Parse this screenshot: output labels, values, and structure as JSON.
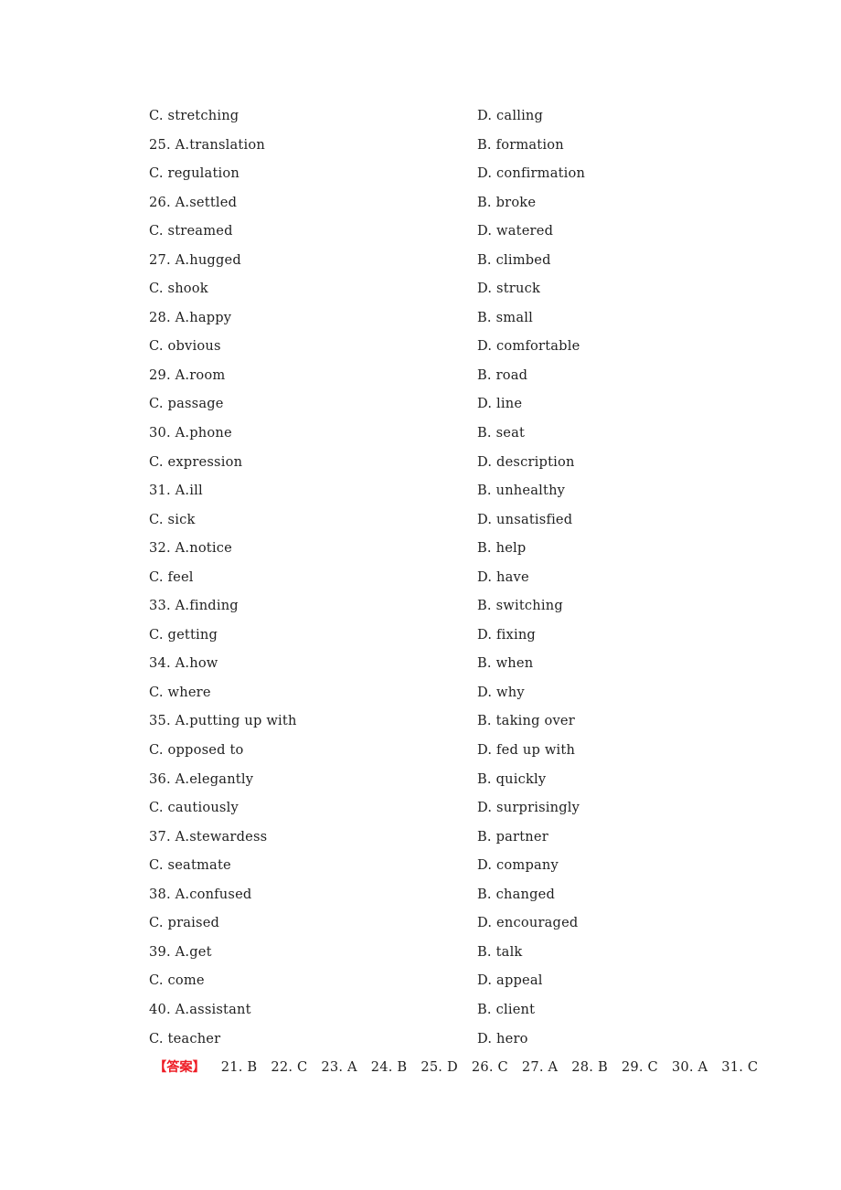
{
  "document": {
    "page_background": "#ffffff",
    "text_color": "#1f1f1f",
    "accent_color": "#ee1c25"
  },
  "option_lines": [
    {
      "left": "C. stretching",
      "right": "D. calling"
    },
    {
      "left": "25. A.translation",
      "right": "B. formation"
    },
    {
      "left": "C. regulation",
      "right": "D. confirmation"
    },
    {
      "left": "26. A.settled",
      "right": "B. broke"
    },
    {
      "left": "C. streamed",
      "right": "D. watered"
    },
    {
      "left": "27. A.hugged",
      "right": "B. climbed"
    },
    {
      "left": "C. shook",
      "right": "D. struck"
    },
    {
      "left": "28. A.happy",
      "right": "B. small"
    },
    {
      "left": "C. obvious",
      "right": "D. comfortable"
    },
    {
      "left": "29. A.room",
      "right": "B. road"
    },
    {
      "left": "C. passage",
      "right": "D. line"
    },
    {
      "left": "30. A.phone",
      "right": "B. seat"
    },
    {
      "left": "C. expression",
      "right": "D. description"
    },
    {
      "left": "31. A.ill",
      "right": "B. unhealthy"
    },
    {
      "left": "C. sick",
      "right": "D. unsatisfied"
    },
    {
      "left": "32. A.notice",
      "right": "B. help"
    },
    {
      "left": "C. feel",
      "right": "D. have"
    },
    {
      "left": "33. A.finding",
      "right": "B. switching"
    },
    {
      "left": "C. getting",
      "right": "D. fixing"
    },
    {
      "left": "34. A.how",
      "right": "B. when"
    },
    {
      "left": "C. where",
      "right": "D. why"
    },
    {
      "left": "35. A.putting up with",
      "right": "B. taking over"
    },
    {
      "left": "C. opposed to",
      "right": "D. fed up with"
    },
    {
      "left": "36. A.elegantly",
      "right": "B. quickly"
    },
    {
      "left": "C. cautiously",
      "right": "D. surprisingly"
    },
    {
      "left": "37. A.stewardess",
      "right": "B. partner"
    },
    {
      "left": "C. seatmate",
      "right": "D. company"
    },
    {
      "left": "38. A.confused",
      "right": "B. changed"
    },
    {
      "left": "C. praised",
      "right": "D. encouraged"
    },
    {
      "left": "39. A.get",
      "right": "B. talk"
    },
    {
      "left": "C. come",
      "right": "D. appeal"
    },
    {
      "left": "40. A.assistant",
      "right": "B. client"
    },
    {
      "left": "C. teacher",
      "right": "D. hero"
    }
  ],
  "answer_key": {
    "label": "【答案】",
    "items": [
      "21. B",
      "22. C",
      "23. A",
      "24. B",
      "25. D",
      "26. C",
      "27. A",
      "28. B",
      "29. C",
      "30. A",
      "31. C"
    ]
  }
}
